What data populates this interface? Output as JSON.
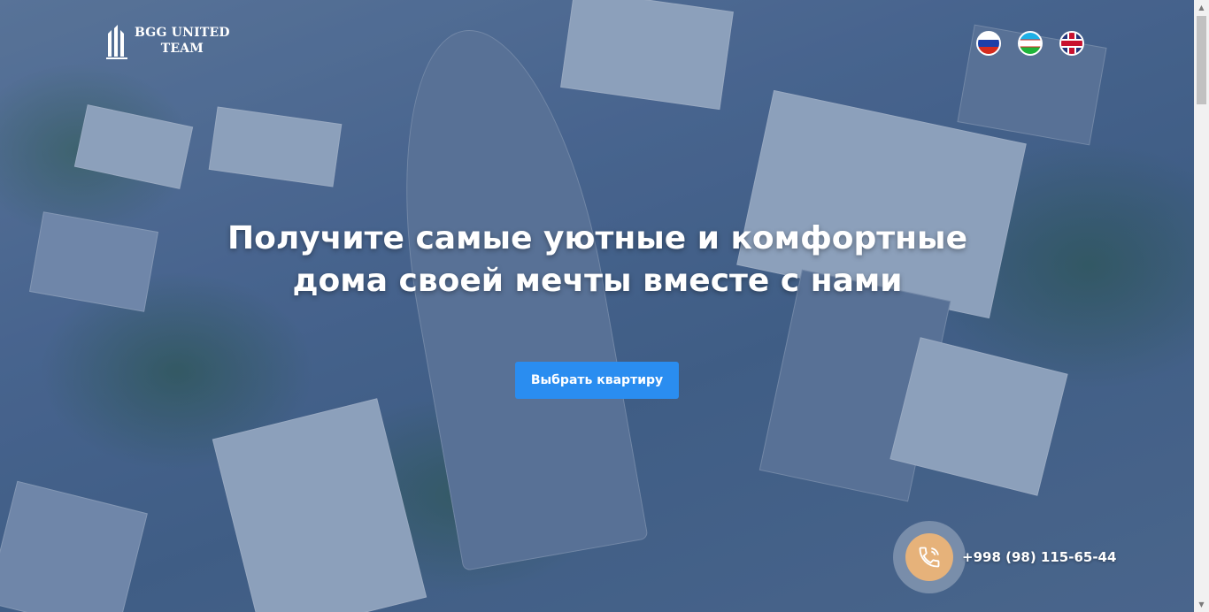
{
  "brand": {
    "line1": "BGG UNITED",
    "line2": "TEAM"
  },
  "languages": [
    {
      "code": "ru",
      "icon": "flag-russia-icon"
    },
    {
      "code": "uz",
      "icon": "flag-uzbekistan-icon"
    },
    {
      "code": "en",
      "icon": "flag-uk-icon"
    }
  ],
  "hero": {
    "title_line1": "Получите самые уютные и комфортные",
    "title_line2": "дома своей мечты вместе с нами",
    "cta_label": "Выбрать квартиру"
  },
  "contact": {
    "phone": "+998 (98) 115-65-44",
    "icon": "phone-icon"
  },
  "colors": {
    "accent": "#2a8df0",
    "phone_button": "#e6b27a"
  }
}
